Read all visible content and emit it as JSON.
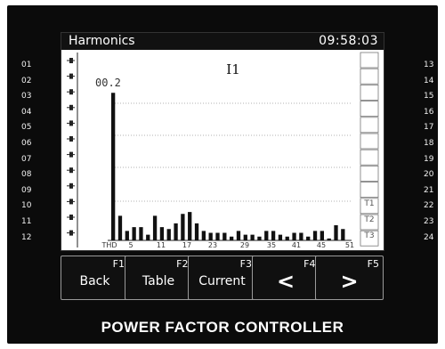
{
  "screen": {
    "title": "Harmonics",
    "clock": "09:58:03"
  },
  "row_numbers": {
    "left": [
      "01",
      "02",
      "03",
      "04",
      "05",
      "06",
      "07",
      "08",
      "09",
      "10",
      "11",
      "12"
    ],
    "right": [
      "13",
      "14",
      "15",
      "16",
      "17",
      "18",
      "19",
      "20",
      "21",
      "22",
      "23",
      "24"
    ]
  },
  "side_tags": [
    "T1",
    "T2",
    "T3"
  ],
  "function_keys": [
    {
      "id": "F1",
      "label": "Back"
    },
    {
      "id": "F2",
      "label": "Table"
    },
    {
      "id": "F3",
      "label": "Current"
    },
    {
      "id": "F4",
      "label": "<"
    },
    {
      "id": "F5",
      "label": ">"
    }
  ],
  "brand": "POWER FACTOR CONTROLLER",
  "chart_data": {
    "type": "bar",
    "title": "I1",
    "peak_label": "00.2",
    "grid": true,
    "tick_labels": [
      "THD",
      "5",
      "11",
      "17",
      "23",
      "29",
      "35",
      "41",
      "45",
      "51"
    ],
    "values": [
      0.78,
      0.13,
      0.05,
      0.07,
      0.07,
      0.03,
      0.13,
      0.07,
      0.06,
      0.09,
      0.14,
      0.15,
      0.09,
      0.05,
      0.04,
      0.04,
      0.04,
      0.02,
      0.05,
      0.03,
      0.03,
      0.02,
      0.05,
      0.05,
      0.03,
      0.02,
      0.04,
      0.04,
      0.02,
      0.05,
      0.05,
      0.01,
      0.08,
      0.06
    ],
    "ylim": [
      0,
      0.8
    ]
  },
  "colors": {
    "background": "#0b0b0b",
    "screen": "#ffffff",
    "bar": "#111111"
  }
}
